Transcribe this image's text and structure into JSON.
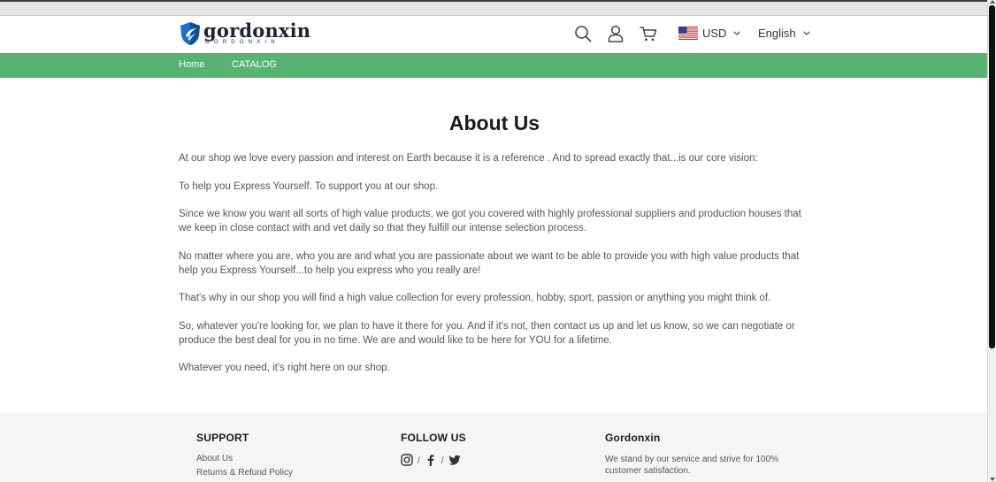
{
  "header": {
    "logo_name": "gordonxin",
    "logo_sub": "GORDONXIN",
    "currency": "USD",
    "language": "English"
  },
  "nav": {
    "items": [
      "Home",
      "CATALOG"
    ]
  },
  "page": {
    "title": "About Us",
    "paragraphs": [
      "At our shop we love every passion and interest on Earth because it is a reference . And to spread exactly that...is our core vision:",
      "To help you Express Yourself. To support you at our shop.",
      "Since we know you want all sorts of high value products, we got you covered with highly professional suppliers and production houses that we keep in close contact with and vet daily so that they fulfill our intense selection process.",
      "No matter where you are, who you are and what you are passionate about we want to be able to provide you with high value products that help you Express Yourself...to help you express who you really are!",
      "That's why in our shop you will find a high value collection for every profession, hobby, sport, passion or anything you might think of.",
      "So, whatever you're looking for, we plan to have it there for you. And if it's not, then contact us up and let us know, so we can negotiate or produce the best deal for you in no time. We are and would like to be here for YOU for a lifetime.",
      "Whatever you need, it's right here on our shop."
    ]
  },
  "footer": {
    "support": {
      "heading": "SUPPORT",
      "links": [
        "About Us",
        "Returns & Refund Policy"
      ]
    },
    "follow": {
      "heading": "FOLLOW US",
      "separator": "/",
      "icons": [
        "instagram-icon",
        "facebook-icon",
        "twitter-icon"
      ]
    },
    "brand": {
      "heading": "Gordonxin",
      "description": "We stand by our service and strive for 100% customer satisfaction."
    }
  },
  "colors": {
    "nav_green": "#58b373",
    "logo_blue": "#1a73c9",
    "footer_bg": "#f5f5f5"
  }
}
